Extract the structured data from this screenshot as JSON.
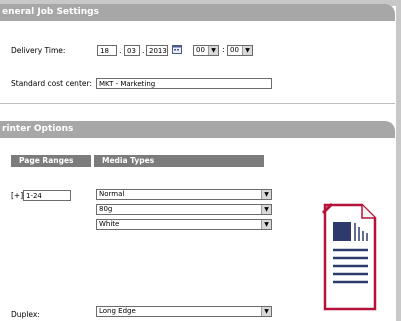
{
  "general": {
    "header": "eneral Job Settings",
    "delivery_time_label": "Delivery Time:",
    "day": "18",
    "month": "03",
    "year": "2013",
    "hour": "00",
    "minute": "00",
    "cost_center_label": "Standard cost center:",
    "cost_center_value": "MKT - Marketing"
  },
  "printer": {
    "header": "rinter Options",
    "page_ranges_header": "Page Ranges",
    "media_types_header": "Media Types",
    "range_expand": "[+]",
    "range_value": "1-24",
    "media_type": "Normal",
    "media_weight": "80g",
    "media_color": "White",
    "duplex_label": "Duplex:",
    "duplex_value": "Long Edge"
  },
  "icons": {
    "calendar": "calendar-icon",
    "document": "document-icon"
  },
  "colors": {
    "header_bg": "#a7a7a7",
    "column_header_bg": "#7c7c7c",
    "doc_accent": "#b5123a",
    "doc_navy": "#2d3a6b"
  }
}
